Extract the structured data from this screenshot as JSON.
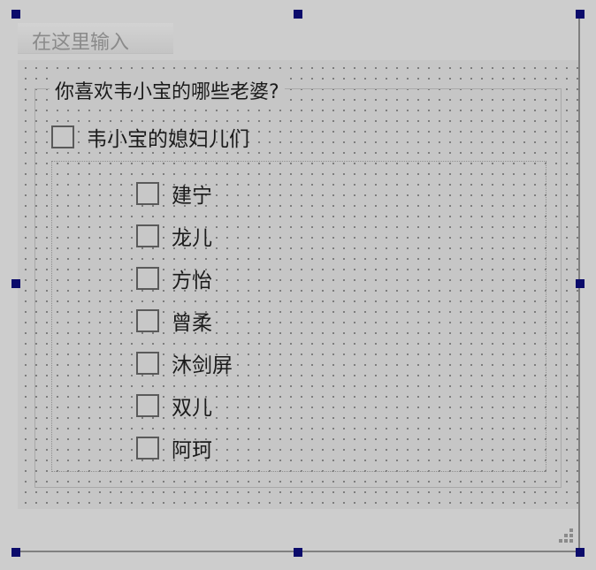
{
  "header": {
    "title_placeholder": "在这里输入"
  },
  "group": {
    "title": "你喜欢韦小宝的哪些老婆?",
    "master_checkbox": {
      "label": "韦小宝的媳妇儿们",
      "checked": false
    },
    "items": [
      {
        "label": "建宁",
        "checked": false
      },
      {
        "label": "龙儿",
        "checked": false
      },
      {
        "label": "方怡",
        "checked": false
      },
      {
        "label": "曾柔",
        "checked": false
      },
      {
        "label": "沐剑屏",
        "checked": false
      },
      {
        "label": "双儿",
        "checked": false
      },
      {
        "label": "阿珂",
        "checked": false
      }
    ]
  },
  "colors": {
    "selection_handle": "#0b0b6b",
    "background": "#c6c6c6",
    "grid_dot": "#6b6b6b"
  }
}
